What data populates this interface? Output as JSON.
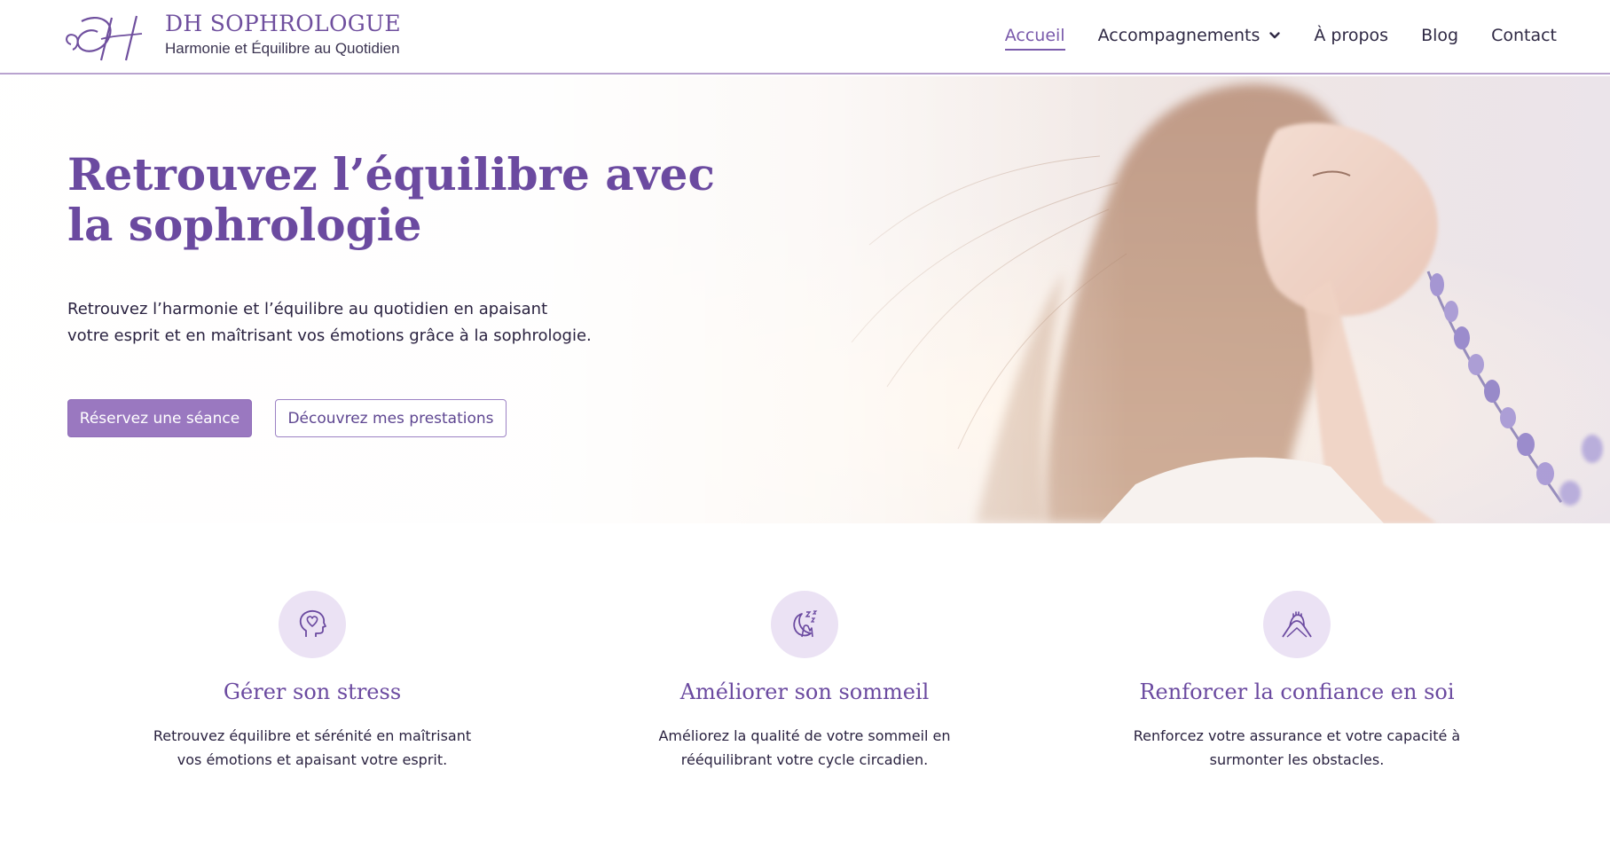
{
  "brand": {
    "name": "DH SOPHROLOGUE",
    "tagline": "Harmonie et Équilibre au Quotidien",
    "logo_icon": "dh-monogram-logo"
  },
  "nav": {
    "items": [
      {
        "label": "Accueil",
        "active": true
      },
      {
        "label": "Accompagnements",
        "has_dropdown": true
      },
      {
        "label": "À propos"
      },
      {
        "label": "Blog"
      },
      {
        "label": "Contact"
      }
    ]
  },
  "hero": {
    "title_line1": "Retrouvez l’équilibre avec",
    "title_line2": "la sophrologie",
    "text_line1": "Retrouvez l’harmonie et l’équilibre au quotidien en apaisant",
    "text_line2": "votre esprit et en maîtrisant vos émotions grâce à la sophrologie.",
    "primary_button": "Réservez une séance",
    "secondary_button": "Découvrez mes prestations",
    "image": "woman-eyes-closed-with-lavender-photo"
  },
  "features": [
    {
      "icon": "head-heart-icon",
      "title": "Gérer son stress",
      "line1": "Retrouvez équilibre et sérénité en maîtrisant",
      "line2": "vos émotions et apaisant votre esprit."
    },
    {
      "icon": "sleep-moon-icon",
      "title": "Améliorer son sommeil",
      "line1": "Améliorez la qualité de votre sommeil en",
      "line2": "rééquilibrant votre cycle circadien."
    },
    {
      "icon": "clasped-hands-icon",
      "title": "Renforcer la confiance en soi",
      "line1": "Renforcez votre assurance et votre capacité à",
      "line2": "surmonter les obstacles."
    }
  ],
  "colors": {
    "brand_purple": "#6b4aa0",
    "button_purple": "#9a78c0",
    "icon_circle": "#ebe2f4",
    "header_border": "#b9a3cf"
  }
}
